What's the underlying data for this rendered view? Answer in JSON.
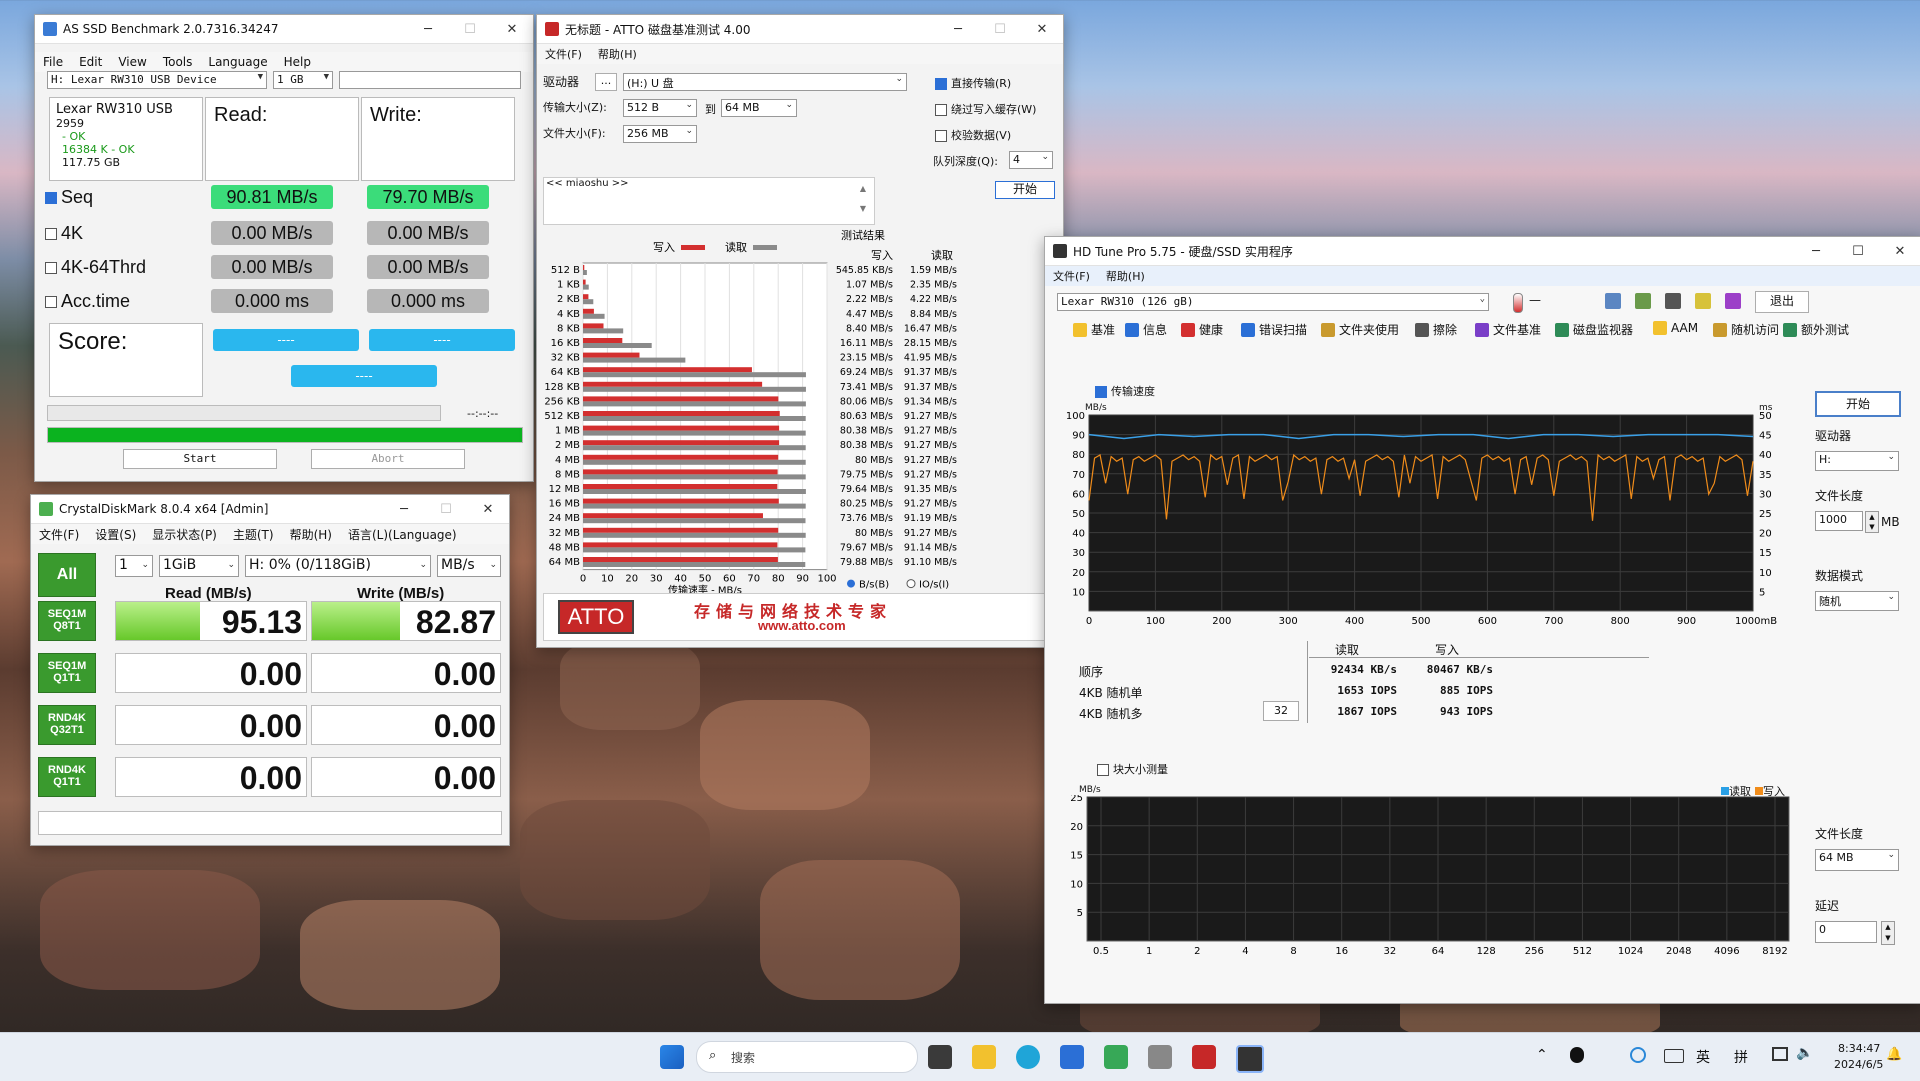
{
  "asssd": {
    "title": "AS SSD Benchmark 2.0.7316.34247",
    "menu": [
      "File",
      "Edit",
      "View",
      "Tools",
      "Language",
      "Help"
    ],
    "drive": "H: Lexar RW310 USB Device",
    "size": "1 GB",
    "info": [
      "Lexar RW310 USB",
      "2959",
      "- OK",
      "16384 K - OK",
      "117.75 GB"
    ],
    "read_hdr": "Read:",
    "write_hdr": "Write:",
    "rows": [
      {
        "label": "Seq",
        "checked": true,
        "read": "90.81 MB/s",
        "write": "79.70 MB/s"
      },
      {
        "label": "4K",
        "checked": false,
        "read": "0.00 MB/s",
        "write": "0.00 MB/s"
      },
      {
        "label": "4K-64Thrd",
        "checked": false,
        "read": "0.00 MB/s",
        "write": "0.00 MB/s"
      },
      {
        "label": "Acc.time",
        "checked": false,
        "read": "0.000 ms",
        "write": "0.000 ms"
      }
    ],
    "score_label": "Score:",
    "score_read": "----",
    "score_write": "----",
    "score_total": "----",
    "time": "--:--:--",
    "progress": 1.0,
    "start": "Start",
    "abort": "Abort"
  },
  "cdm": {
    "title": "CrystalDiskMark 8.0.4 x64 [Admin]",
    "menu": [
      "文件(F)",
      "设置(S)",
      "显示状态(P)",
      "主题(T)",
      "帮助(H)",
      "语言(L)(Language)"
    ],
    "all": "All",
    "count": "1",
    "size": "1GiB",
    "drive": "H: 0% (0/118GiB)",
    "unit": "MB/s",
    "read_hdr": "Read (MB/s)",
    "write_hdr": "Write (MB/s)",
    "rows": [
      {
        "l1": "SEQ1M",
        "l2": "Q8T1",
        "read": "95.13",
        "write": "82.87",
        "rf": 0.44,
        "wf": 0.47
      },
      {
        "l1": "SEQ1M",
        "l2": "Q1T1",
        "read": "0.00",
        "write": "0.00",
        "rf": 0,
        "wf": 0
      },
      {
        "l1": "RND4K",
        "l2": "Q32T1",
        "read": "0.00",
        "write": "0.00",
        "rf": 0,
        "wf": 0
      },
      {
        "l1": "RND4K",
        "l2": "Q1T1",
        "read": "0.00",
        "write": "0.00",
        "rf": 0,
        "wf": 0
      }
    ]
  },
  "atto": {
    "title": "无标题 - ATTO 磁盘基准测试 4.00",
    "menu": [
      "文件(F)",
      "帮助(H)"
    ],
    "drive_label": "驱动器",
    "browse": "...",
    "drive": "(H:) U 盘",
    "xfer_label": "传输大小(Z):",
    "xfer_from": "512 B",
    "to_label": "到",
    "xfer_to": "64 MB",
    "file_label": "文件大小(F):",
    "file_size": "256 MB",
    "direct_io": "直接传输(R)",
    "bypass": "绕过写入缓存(W)",
    "verify": "校验数据(V)",
    "queue_label": "队列深度(Q):",
    "queue": "4",
    "start": "开始",
    "desc": "<< miaoshu >>",
    "results_label": "测试结果",
    "write_legend": "写入",
    "read_legend": "读取",
    "col_write": "写入",
    "col_read": "读取",
    "xaxis_label": "传输速率 - MB/s",
    "unit_b": "B/s(B)",
    "unit_io": "IO/s(I)",
    "logo": "ATTO",
    "slogan": "存储与网络技术专家",
    "url": "www.atto.com",
    "ticks": [
      0,
      10,
      20,
      30,
      40,
      50,
      60,
      70,
      80,
      90,
      100
    ]
  },
  "chart_data": [
    {
      "type": "bar",
      "title": "测试结果",
      "xlabel": "传输速率 - MB/s",
      "xlim": [
        0,
        100
      ],
      "categories": [
        "512 B",
        "1 KB",
        "2 KB",
        "4 KB",
        "8 KB",
        "16 KB",
        "32 KB",
        "64 KB",
        "128 KB",
        "256 KB",
        "512 KB",
        "1 MB",
        "2 MB",
        "4 MB",
        "8 MB",
        "12 MB",
        "16 MB",
        "24 MB",
        "32 MB",
        "48 MB",
        "64 MB"
      ],
      "series": [
        {
          "name": "写入",
          "values": [
            0.53,
            1.07,
            2.22,
            4.47,
            8.4,
            16.11,
            23.15,
            69.24,
            73.41,
            80.06,
            80.63,
            80.38,
            80.38,
            80,
            79.75,
            79.64,
            80.25,
            73.76,
            80,
            79.67,
            79.88
          ],
          "labels": [
            "545.85 KB/s",
            "1.07 MB/s",
            "2.22 MB/s",
            "4.47 MB/s",
            "8.40 MB/s",
            "16.11 MB/s",
            "23.15 MB/s",
            "69.24 MB/s",
            "73.41 MB/s",
            "80.06 MB/s",
            "80.63 MB/s",
            "80.38 MB/s",
            "80.38 MB/s",
            "80 MB/s",
            "79.75 MB/s",
            "79.64 MB/s",
            "80.25 MB/s",
            "73.76 MB/s",
            "80 MB/s",
            "79.67 MB/s",
            "79.88 MB/s"
          ]
        },
        {
          "name": "读取",
          "values": [
            1.59,
            2.35,
            4.22,
            8.84,
            16.47,
            28.15,
            41.95,
            91.37,
            91.37,
            91.34,
            91.27,
            91.27,
            91.27,
            91.27,
            91.27,
            91.35,
            91.27,
            91.19,
            91.27,
            91.14,
            91.1
          ],
          "labels": [
            "1.59 MB/s",
            "2.35 MB/s",
            "4.22 MB/s",
            "8.84 MB/s",
            "16.47 MB/s",
            "28.15 MB/s",
            "41.95 MB/s",
            "91.37 MB/s",
            "91.37 MB/s",
            "91.34 MB/s",
            "91.27 MB/s",
            "91.27 MB/s",
            "91.27 MB/s",
            "91.27 MB/s",
            "91.27 MB/s",
            "91.35 MB/s",
            "91.27 MB/s",
            "91.19 MB/s",
            "91.27 MB/s",
            "91.14 MB/s",
            "91.10 MB/s"
          ]
        }
      ]
    },
    {
      "type": "line",
      "xlabel": "mB",
      "ylabel": "MB/s",
      "xlim": [
        0,
        1000
      ],
      "ylim": [
        0,
        100
      ],
      "y2label": "ms",
      "y2lim": [
        0,
        50
      ],
      "xticks": [
        0,
        100,
        200,
        300,
        400,
        500,
        600,
        700,
        800,
        900,
        1000
      ],
      "yticks": [
        10,
        20,
        30,
        40,
        50,
        60,
        70,
        80,
        90,
        100
      ],
      "y2ticks": [
        5,
        10,
        15,
        20,
        25,
        30,
        35,
        40,
        45,
        50
      ],
      "series": [
        {
          "name": "传输速度",
          "values": [
            90,
            88,
            90,
            89,
            90,
            90,
            88,
            90,
            90,
            89,
            90,
            90,
            88,
            90,
            90,
            89,
            90,
            90,
            90,
            89
          ]
        }
      ]
    }
  ],
  "hdtune": {
    "title": "HD Tune Pro 5.75 - 硬盘/SSD 实用程序",
    "menu": [
      "文件(F)",
      "帮助(H)"
    ],
    "drive": "Lexar   RW310 (126 gB)",
    "temp": "—",
    "exit": "退出",
    "tabs": [
      "基准",
      "信息",
      "健康",
      "错误扫描",
      "文件夹使用",
      "擦除",
      "文件基准",
      "磁盘监视器",
      "AAM",
      "随机访问",
      "额外测试"
    ],
    "transfer_check": "传输速度",
    "start": "开始",
    "drive_label": "驱动器",
    "drive_sel": "H:",
    "length_label": "文件长度",
    "length": "1000",
    "length_unit": "MB",
    "pattern_label": "数据模式",
    "pattern": "随机",
    "unit_left": "MB/s",
    "unit_right": "ms",
    "xunit": "1000mB",
    "hdr_read": "读取",
    "hdr_write": "写入",
    "res_rows": [
      {
        "label": "顺序",
        "read": "92434 KB/s",
        "write": "80467 KB/s"
      },
      {
        "label": "4KB 随机单",
        "read": "1653 IOPS",
        "write": "885 IOPS"
      },
      {
        "label": "4KB 随机多",
        "read": "1867 IOPS",
        "write": "943 IOPS"
      }
    ],
    "queue": "32",
    "block_check": "块大小测量",
    "block_unit": "MB/s",
    "legend_read": "读取",
    "legend_write": "写入",
    "block_yticks": [
      "25",
      "20",
      "15",
      "10",
      "5"
    ],
    "block_xticks": [
      "0.5",
      "1",
      "2",
      "4",
      "8",
      "16",
      "32",
      "64",
      "128",
      "256",
      "512",
      "1024",
      "2048",
      "4096",
      "8192"
    ],
    "file_len_label": "文件长度",
    "file_len": "64 MB",
    "delay_label": "延迟",
    "delay": "0"
  },
  "taskbar": {
    "search": "搜索",
    "lang": "英",
    "ime": "拼",
    "time": "8:34:47",
    "date": "2024/6/5"
  }
}
